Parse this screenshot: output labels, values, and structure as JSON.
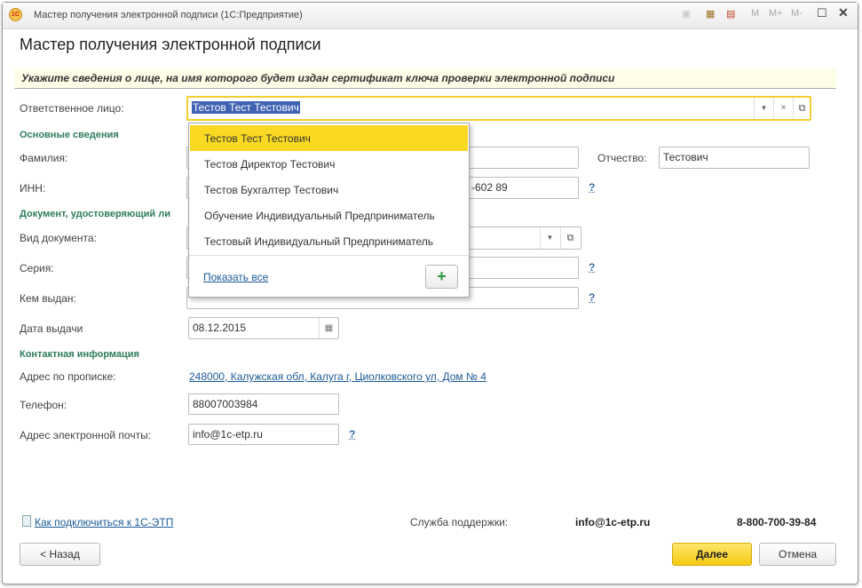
{
  "window": {
    "title": "Мастер получения электронной подписи  (1С:Предприятие)",
    "toolbar": [
      "M",
      "M+",
      "M-"
    ]
  },
  "heading": "Мастер получения электронной подписи",
  "info": "Укажите сведения о лице, на имя которого будет издан сертификат ключа проверки электронной подписи",
  "responsible": {
    "label": "Ответственное лицо:",
    "value": "Тестов Тест Тестович"
  },
  "sections": {
    "main": "Основные сведения",
    "document": "Документ, удостоверяющий ли",
    "contact": "Контактная информация"
  },
  "fields": {
    "surname": {
      "label": "Фамилия:"
    },
    "patronymic": {
      "label": "Отчество:",
      "value": "Тестович"
    },
    "inn": {
      "label": "ИНН:",
      "value": "-602 89"
    },
    "doc_type": {
      "label": "Вид документа:"
    },
    "series": {
      "label": "Серия:"
    },
    "issued_by": {
      "label": "Кем выдан:"
    },
    "issue_date": {
      "label": "Дата выдачи",
      "value": "08.12.2015"
    },
    "address": {
      "label": "Адрес по прописке:",
      "value": "248000, Калужская обл, Калуга г, Циолковского ул, Дом № 4"
    },
    "phone": {
      "label": "Телефон:",
      "value": "88007003984"
    },
    "email": {
      "label": "Адрес электронной почты:",
      "value": "info@1c-etp.ru"
    }
  },
  "help": "?",
  "dropdown": {
    "items": [
      "Тестов Тест Тестович",
      "Тестов Директор Тестович",
      "Тестов Бухгалтер Тестович",
      "Обучение Индивидуальный Предприниматель",
      "Тестовый Индивидуальный Предприниматель"
    ],
    "show_all": "Показать все",
    "add": "+"
  },
  "footer": {
    "howto": "Как подключиться к 1С-ЭТП",
    "support_label": "Служба поддержки:",
    "support_email": "info@1c-etp.ru",
    "support_phone": "8-800-700-39-84"
  },
  "buttons": {
    "back": "< Назад",
    "next": "Далее",
    "cancel": "Отмена"
  },
  "colors": {
    "accent": "#f9d922",
    "section": "#2e7d5a",
    "link": "#1a5a96"
  }
}
